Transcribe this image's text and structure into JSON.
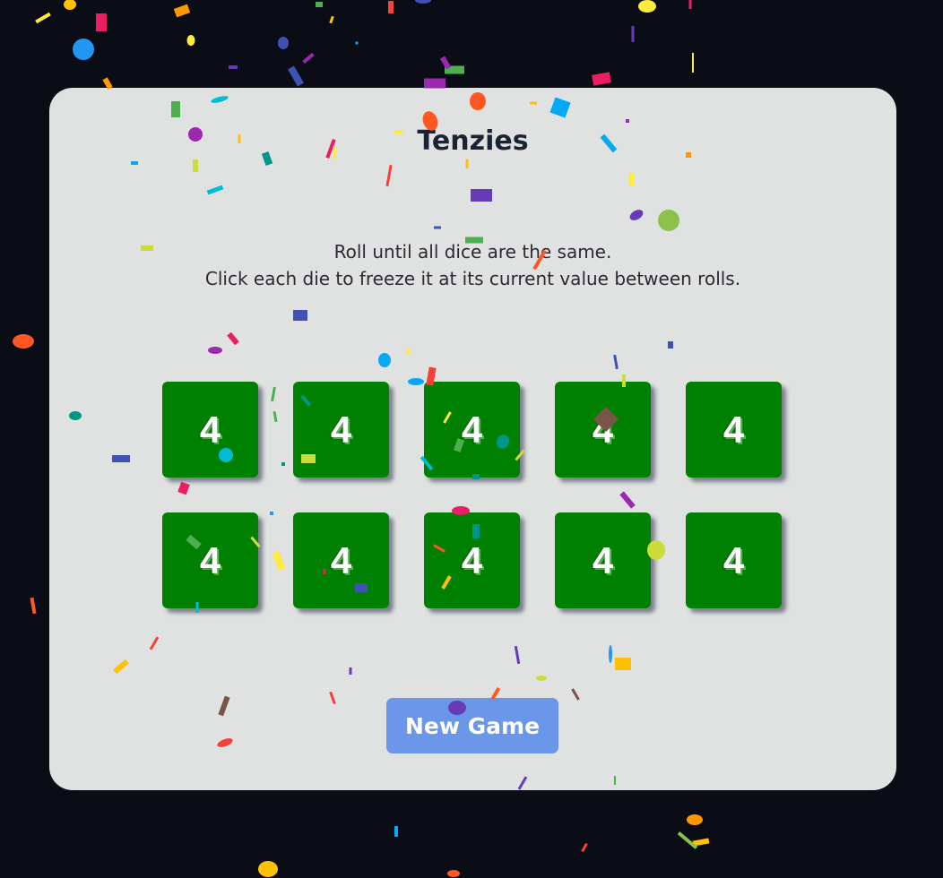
{
  "title": "Tenzies",
  "instructions": {
    "line1": "Roll until all dice are the same.",
    "line2": "Click each die to freeze it at its current value between rolls."
  },
  "dice": [
    {
      "value": "4",
      "held": true
    },
    {
      "value": "4",
      "held": true
    },
    {
      "value": "4",
      "held": true
    },
    {
      "value": "4",
      "held": true
    },
    {
      "value": "4",
      "held": true
    },
    {
      "value": "4",
      "held": true
    },
    {
      "value": "4",
      "held": true
    },
    {
      "value": "4",
      "held": true
    },
    {
      "value": "4",
      "held": true
    },
    {
      "value": "4",
      "held": true
    }
  ],
  "new_game_label": "New Game",
  "colors": {
    "background": "#0a0d15",
    "card": "#e0e2e1",
    "die_held": "#008000",
    "button": "#6a97e8",
    "title": "#1a2433"
  },
  "status": "won",
  "confetti_colors": [
    "#f44336",
    "#e91e63",
    "#9c27b0",
    "#673ab7",
    "#3f51b5",
    "#2196f3",
    "#03a9f4",
    "#00bcd4",
    "#009688",
    "#4caf50",
    "#8bc34a",
    "#cddc39",
    "#ffeb3b",
    "#ffc107",
    "#ff9800",
    "#ff5722",
    "#795548"
  ]
}
